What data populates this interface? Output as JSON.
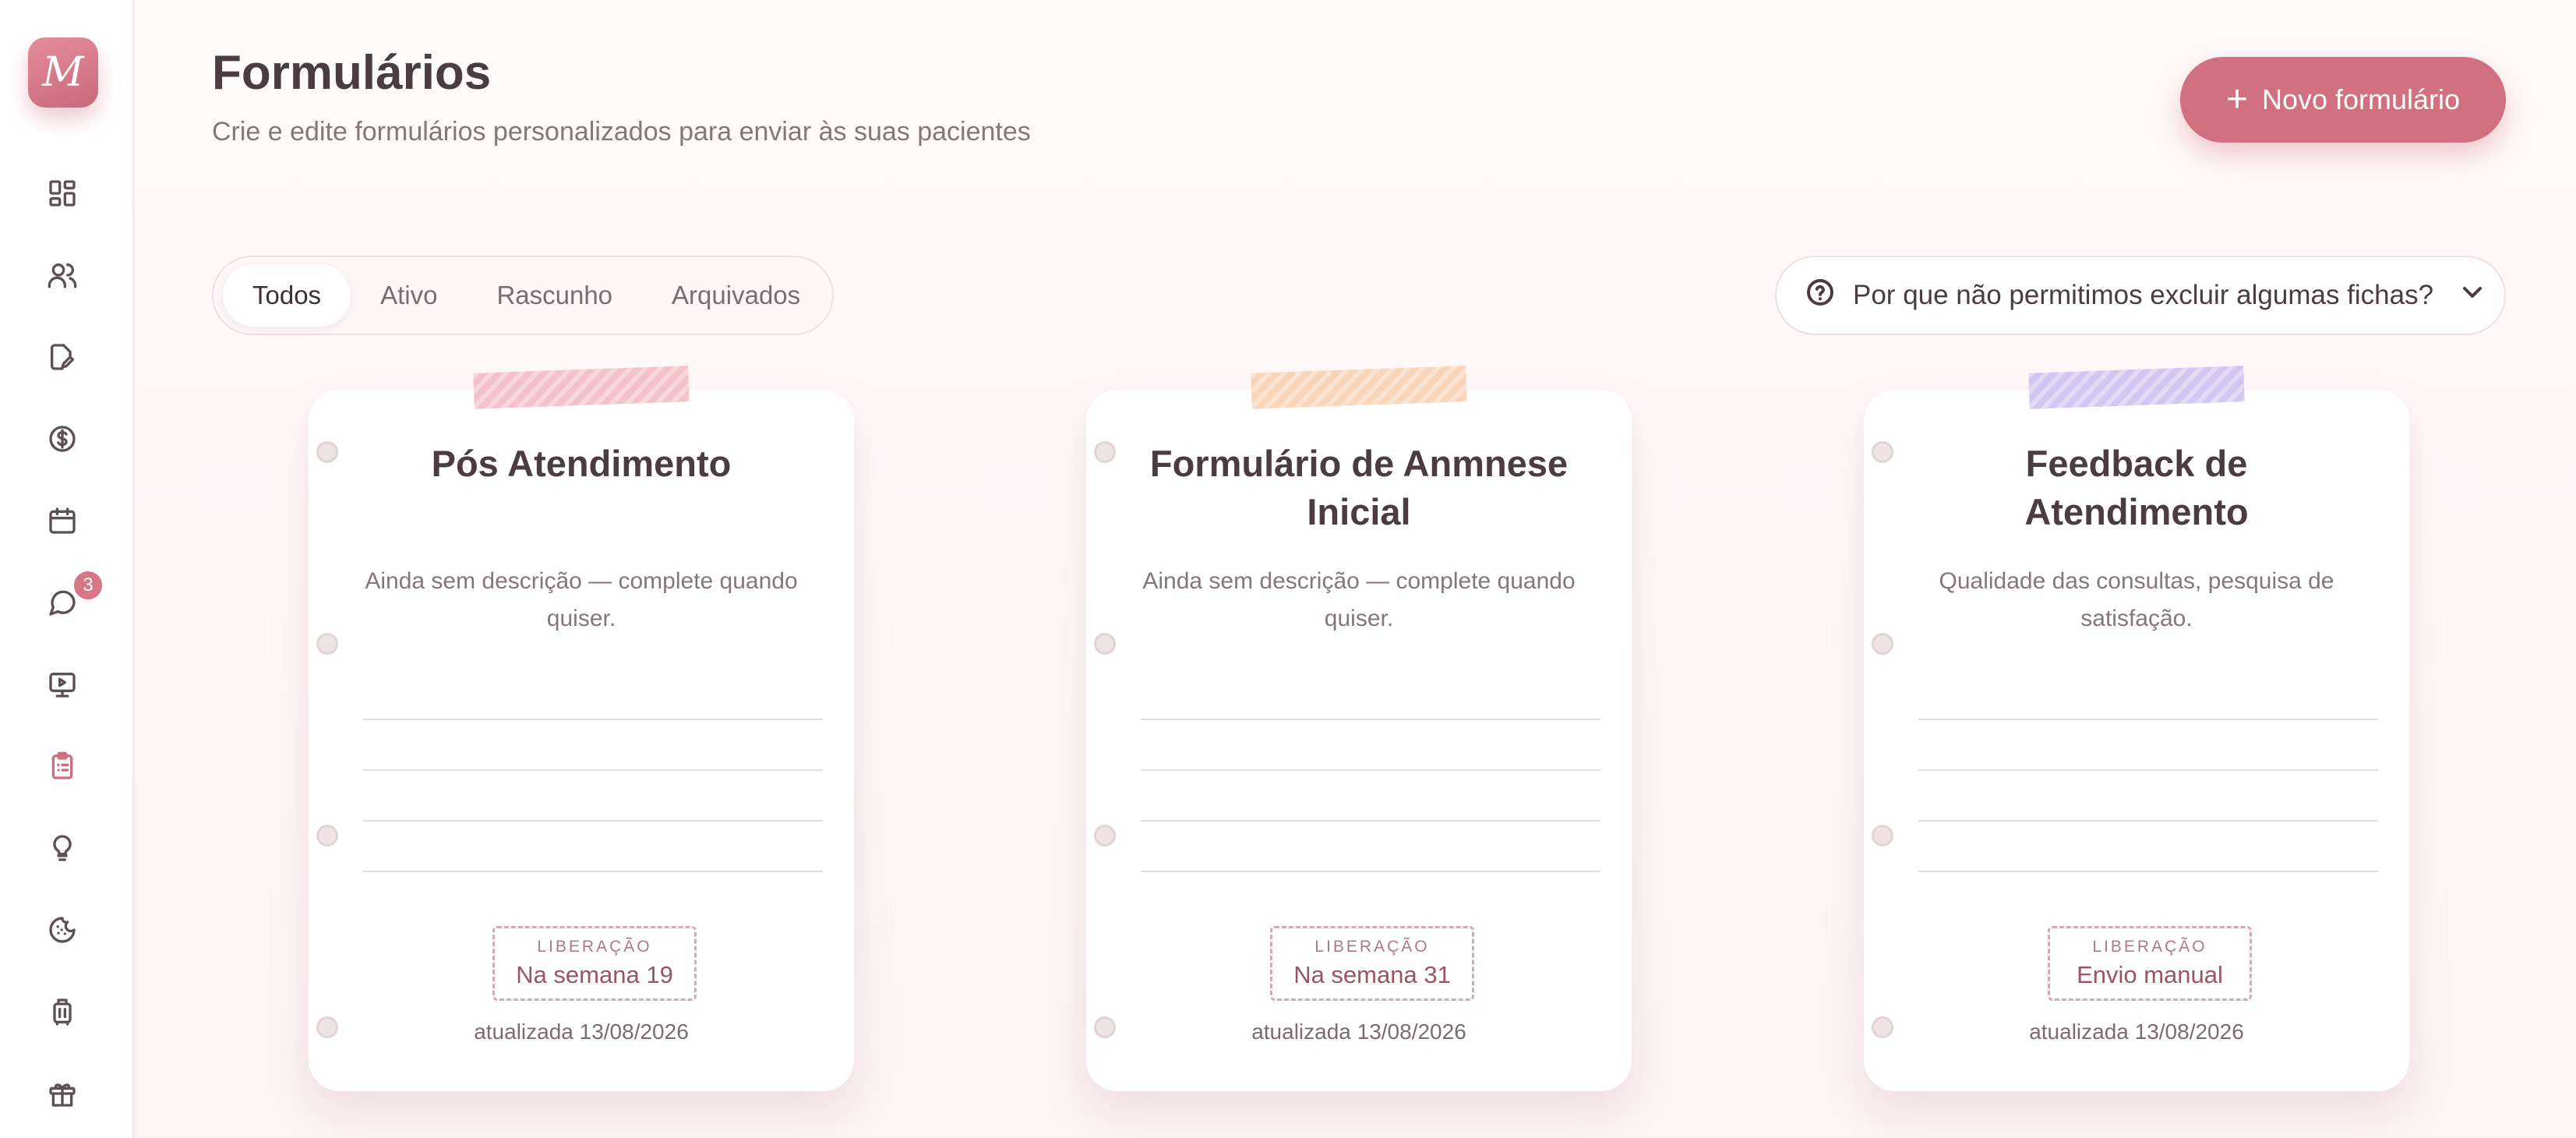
{
  "app": {
    "logo_letter": "M"
  },
  "sidebar": {
    "badge_count": "3",
    "items": [
      {
        "name": "dashboard-icon"
      },
      {
        "name": "users-icon"
      },
      {
        "name": "document-edit-icon"
      },
      {
        "name": "dollar-icon"
      },
      {
        "name": "calendar-icon"
      },
      {
        "name": "chat-icon"
      },
      {
        "name": "video-presentation-icon"
      },
      {
        "name": "clipboard-list-icon",
        "active": true
      },
      {
        "name": "lightbulb-icon"
      },
      {
        "name": "cookie-icon"
      },
      {
        "name": "luggage-icon"
      },
      {
        "name": "gift-icon"
      }
    ]
  },
  "header": {
    "title": "Formulários",
    "subtitle": "Crie e edite formulários personalizados para enviar às suas pacientes",
    "new_button_label": "Novo formulário"
  },
  "tabs": [
    {
      "label": "Todos",
      "active": true
    },
    {
      "label": "Ativo"
    },
    {
      "label": "Rascunho"
    },
    {
      "label": "Arquivados"
    }
  ],
  "help": {
    "label": "Por que não permitimos excluir algumas fichas?"
  },
  "colors": {
    "accent": "#d1707f",
    "tape_pink": "#f2b9c3",
    "tape_peach": "#f8cfae",
    "tape_lavender": "#cbbdf0"
  },
  "cards": [
    {
      "title": "Pós Atendimento",
      "description": "Ainda sem descrição — complete quando quiser.",
      "release_label": "LIBERAÇÃO",
      "release_value": "Na semana 19",
      "updated": "atualizada 13/08/2026"
    },
    {
      "title": "Formulário de Anmnese Inicial",
      "description": "Ainda sem descrição — complete quando quiser.",
      "release_label": "LIBERAÇÃO",
      "release_value": "Na semana 31",
      "updated": "atualizada 13/08/2026"
    },
    {
      "title": "Feedback de Atendimento",
      "description": "Qualidade das consultas, pesquisa de satisfação.",
      "release_label": "LIBERAÇÃO",
      "release_value": "Envio manual",
      "updated": "atualizada 13/08/2026"
    }
  ]
}
